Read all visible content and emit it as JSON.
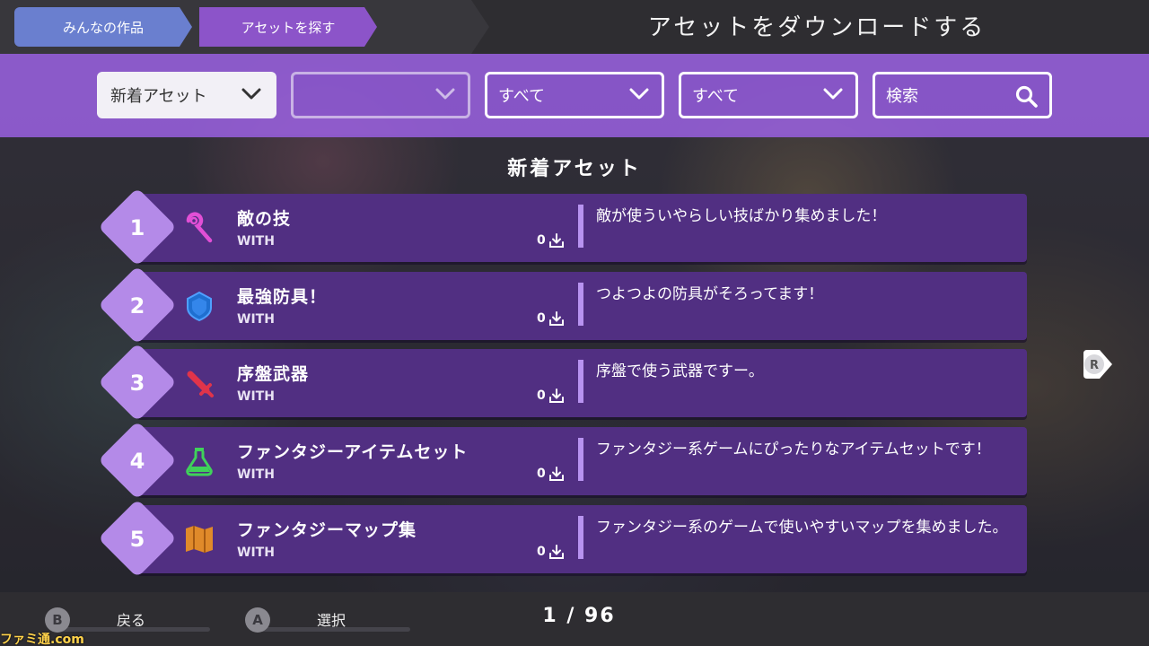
{
  "header": {
    "breadcrumbs": [
      "みんなの作品",
      "アセットを探す"
    ],
    "title": "アセットをダウンロードする"
  },
  "filters": {
    "sort": "新着アセット",
    "category": "",
    "type1": "すべて",
    "type2": "すべて",
    "search_placeholder": "検索"
  },
  "section_title": "新着アセット",
  "assets": [
    {
      "rank": "1",
      "icon": "wand-icon",
      "name": "敵の技",
      "author": "WITH",
      "downloads": "0",
      "description": "敵が使ういやらしい技ばかり集めました！"
    },
    {
      "rank": "2",
      "icon": "shield-icon",
      "name": "最強防具！",
      "author": "WITH",
      "downloads": "0",
      "description": "つよつよの防具がそろってます！"
    },
    {
      "rank": "3",
      "icon": "sword-icon",
      "name": "序盤武器",
      "author": "WITH",
      "downloads": "0",
      "description": "序盤で使う武器ですー。"
    },
    {
      "rank": "4",
      "icon": "potion-icon",
      "name": "ファンタジーアイテムセット",
      "author": "WITH",
      "downloads": "0",
      "description": "ファンタジー系ゲームにぴったりなアイテムセットです！"
    },
    {
      "rank": "5",
      "icon": "map-icon",
      "name": "ファンタジーマップ集",
      "author": "WITH",
      "downloads": "0",
      "description": "ファンタジー系のゲームで使いやすいマップを集めました。"
    }
  ],
  "next_page_button": "R",
  "footer": {
    "back_key": "B",
    "back_label": "戻る",
    "select_key": "A",
    "select_label": "選択",
    "page": "1 / 96"
  },
  "watermark": "ファミ通.com",
  "colors": {
    "filter_bar": "#9a5fdc",
    "row_bg": "#512f82",
    "rank_badge": "#b48ae8",
    "crumb_active": "#8c54c9",
    "crumb_home": "#6a7fcf"
  }
}
